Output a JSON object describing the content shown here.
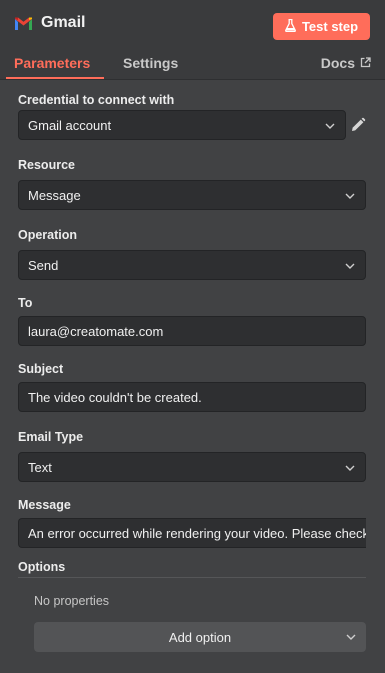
{
  "header": {
    "app_name": "Gmail",
    "test_step_label": "Test step",
    "icons": {
      "app": "gmail-icon",
      "test": "flask-icon",
      "docs": "external-link-icon"
    }
  },
  "tabs": [
    {
      "label": "Parameters",
      "active": true
    },
    {
      "label": "Settings",
      "active": false
    }
  ],
  "docs_label": "Docs",
  "fields": {
    "credential": {
      "label": "Credential to connect with",
      "value": "Gmail account"
    },
    "resource": {
      "label": "Resource",
      "value": "Message"
    },
    "operation": {
      "label": "Operation",
      "value": "Send"
    },
    "to": {
      "label": "To",
      "value": "laura@creatomate.com"
    },
    "subject": {
      "label": "Subject",
      "value": "The video couldn't be created."
    },
    "email_type": {
      "label": "Email Type",
      "value": "Text"
    },
    "message": {
      "label": "Message",
      "value": "An error occurred while rendering your video. Please check"
    }
  },
  "options": {
    "label": "Options",
    "empty_text": "No properties",
    "add_label": "Add option"
  },
  "colors": {
    "accent": "#ff6d5a",
    "background": "#414244",
    "input_bg": "#2e2f31"
  }
}
